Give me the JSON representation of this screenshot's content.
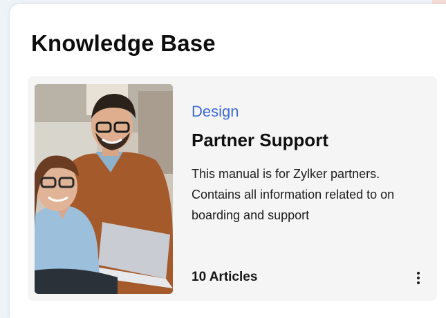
{
  "page": {
    "title": "Knowledge Base"
  },
  "card": {
    "category": "Design",
    "title": "Partner Support",
    "description": "This manual is for Zylker partners. Contains all information related to on boarding and support",
    "article_count": "10 Articles",
    "more_icon": "more-vertical-icon",
    "image_icon": "team-photo"
  },
  "colors": {
    "category_accent": "#3e6ad8",
    "card_background": "#f5f5f6",
    "page_background": "#eef3f8"
  }
}
